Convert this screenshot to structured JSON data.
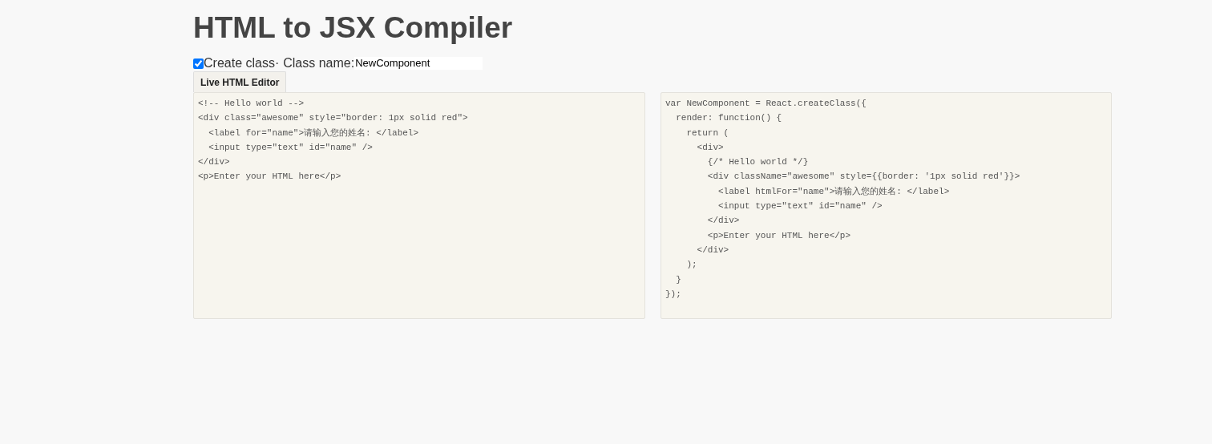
{
  "title": "HTML to JSX Compiler",
  "options": {
    "create_class": {
      "label": "Create class·",
      "checked": true
    },
    "class_name": {
      "label": "Class name:",
      "value": "NewComponent"
    }
  },
  "tabs": [
    {
      "label": "Live HTML Editor",
      "selected": true
    }
  ],
  "input_code": "<!-- Hello world -->\n<div class=\"awesome\" style=\"border: 1px solid red\">\n  <label for=\"name\">请输入您的姓名: </label>\n  <input type=\"text\" id=\"name\" />\n</div>\n<p>Enter your HTML here</p>",
  "output_code": "var NewComponent = React.createClass({\n  render: function() {\n    return (\n      <div>\n        {/* Hello world */}\n        <div className=\"awesome\" style={{border: '1px solid red'}}>\n          <label htmlFor=\"name\">请输入您的姓名: </label>\n          <input type=\"text\" id=\"name\" />\n        </div>\n        <p>Enter your HTML here</p>\n      </div>\n    );\n  }\n});"
}
